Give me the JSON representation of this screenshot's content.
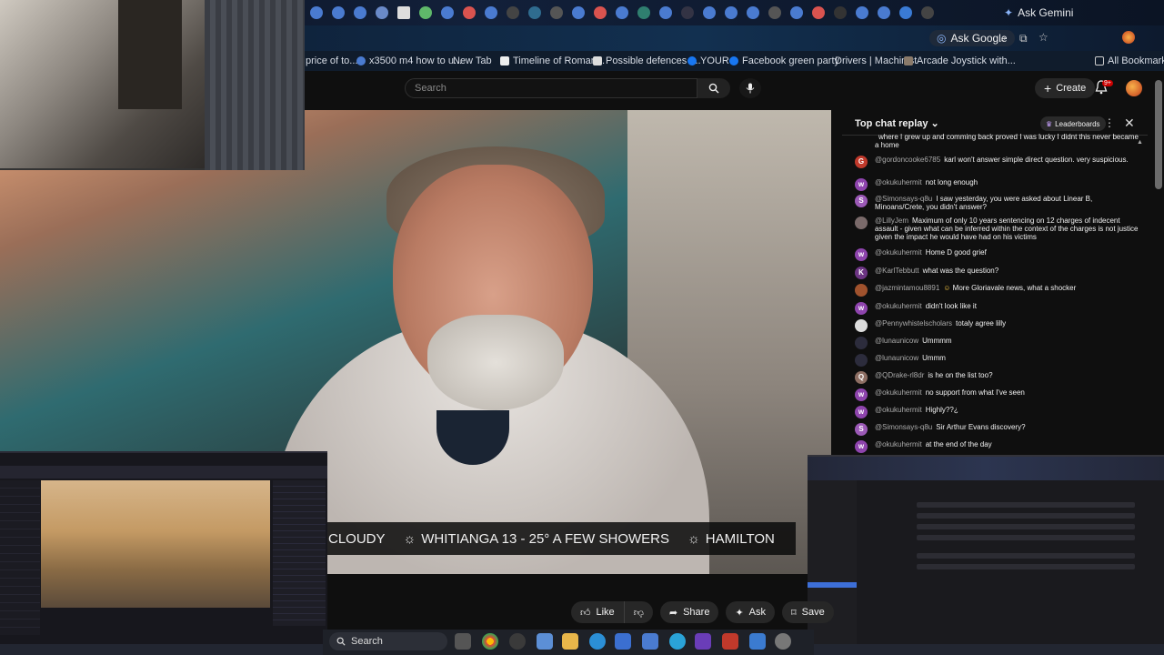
{
  "browser": {
    "ask_gemini": "Ask Gemini",
    "ask_google": "Ask Google",
    "bookmarks": [
      {
        "label": "price of to..."
      },
      {
        "label": "x3500 m4 how to u..."
      },
      {
        "label": "New Tab"
      },
      {
        "label": "Timeline of Roman..."
      },
      {
        "label": "Possible defences t..."
      },
      {
        "label": "YOUR"
      },
      {
        "label": "Facebook green party"
      },
      {
        "label": "Drivers | Machinist"
      },
      {
        "label": "Arcade Joystick with..."
      }
    ],
    "all_bookmarks": "All Bookmarks"
  },
  "youtube": {
    "search_placeholder": "Search",
    "create_label": "Create",
    "notif_count": "9+"
  },
  "ticker": {
    "items": [
      "CLOUDY",
      "WHITIANGA 13 - 25° A FEW SHOWERS",
      "HAMILTON"
    ]
  },
  "chat": {
    "title": "Top chat replay",
    "leaderboards": "Leaderboards",
    "messages": [
      {
        "author": "",
        "text": "where I grew up and comming back proved I was lucky I didnt this never became a home",
        "initial": "",
        "color": "#0f0f0f"
      },
      {
        "author": "@gordoncooke6785",
        "text": "karl won't answer simple direct question. very suspicious.",
        "initial": "G",
        "color": "#c0392b"
      },
      {
        "author": "@okukuhermit",
        "text": "not long enough",
        "initial": "w",
        "color": "#8e44ad"
      },
      {
        "author": "@Simonsays-q8u",
        "text": "I saw yesterday, you were asked about Linear B, Minoans/Crete, you didn't answer?",
        "initial": "S",
        "color": "#9b59b6"
      },
      {
        "author": "@LillyJem",
        "text": "Maximum of only 10 years sentencing on 12 charges of indecent assault - given what can be inferred within the context of the charges is not justice given the impact he would have had on his victims",
        "initial": "",
        "color": "#7a6a6a"
      },
      {
        "author": "@okukuhermit",
        "text": "Home D good grief",
        "initial": "w",
        "color": "#8e44ad"
      },
      {
        "author": "@KarlTebbutt",
        "text": "what was the question?",
        "initial": "K",
        "color": "#6c3483"
      },
      {
        "author": "@jazmintamou8891",
        "text": "More Gloriavale news, what a shocker",
        "initial": "",
        "color": "#a0522d"
      },
      {
        "author": "@okukuhermit",
        "text": "didn't look like it",
        "initial": "w",
        "color": "#8e44ad"
      },
      {
        "author": "@Pennywhistelscholars",
        "text": "totaly agree lilly",
        "initial": "",
        "color": "#dddddd"
      },
      {
        "author": "@lunaunicow",
        "text": "Ummmm",
        "initial": "",
        "color": "#2c2c3c"
      },
      {
        "author": "@lunaunicow",
        "text": "Ummm",
        "initial": "",
        "color": "#2c2c3c"
      },
      {
        "author": "@QDrake-rl8dr",
        "text": "is he on the list too?",
        "initial": "Q",
        "color": "#8d6e63"
      },
      {
        "author": "@okukuhermit",
        "text": "no support from what I've seen",
        "initial": "w",
        "color": "#8e44ad"
      },
      {
        "author": "@okukuhermit",
        "text": "Highly??¿",
        "initial": "w",
        "color": "#8e44ad"
      },
      {
        "author": "@Simonsays-q8u",
        "text": "Sir Arthur Evans discovery?",
        "initial": "S",
        "color": "#9b59b6"
      },
      {
        "author": "@okukuhermit",
        "text": "at the end of the day",
        "initial": "w",
        "color": "#8e44ad"
      }
    ]
  },
  "actions": {
    "like": "Like",
    "share": "Share",
    "ask": "Ask",
    "save": "Save"
  },
  "taskbar": {
    "search_label": "Search"
  }
}
